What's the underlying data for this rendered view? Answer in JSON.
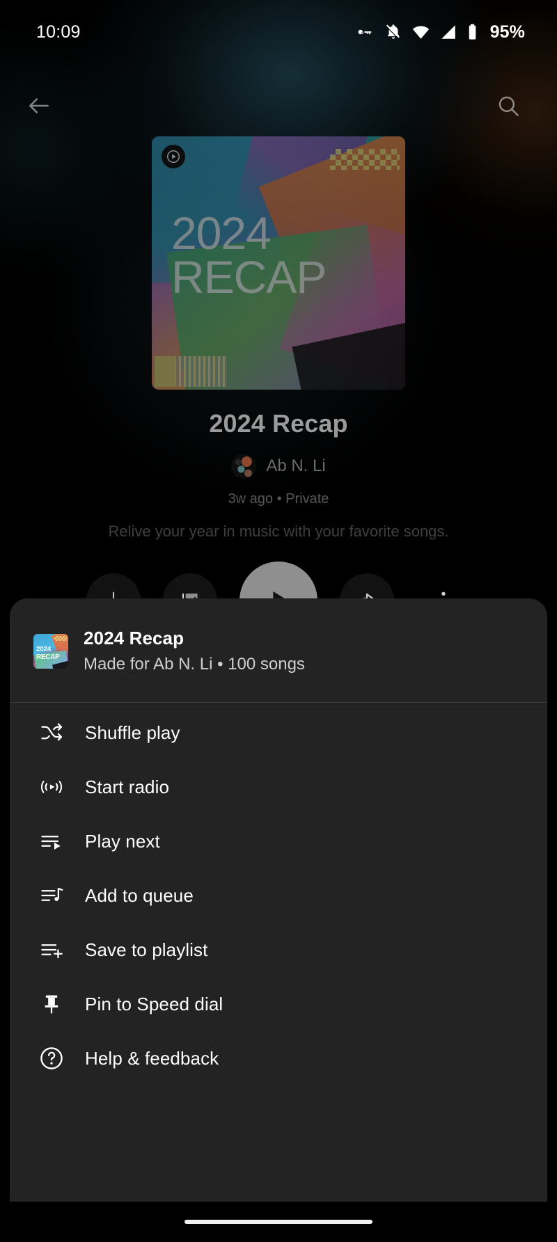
{
  "status_bar": {
    "time": "10:09",
    "battery_percent": "95%",
    "icons": [
      "key-icon",
      "notifications-muted-icon",
      "wifi-icon",
      "cellular-signal-icon",
      "battery-icon"
    ]
  },
  "app_bar": {
    "back_label": "back-arrow-icon",
    "search_label": "search-icon"
  },
  "hero": {
    "artwork": {
      "line1": "2024",
      "line2": "RECAP",
      "badge": "play-badge-icon"
    },
    "title": "2024 Recap",
    "owner": "Ab N. Li",
    "meta": "3w ago • Private",
    "description": "Relive your year in music with your favorite songs."
  },
  "actions": [
    {
      "name": "download-button",
      "icon": "download-arrow-icon"
    },
    {
      "name": "saved-button",
      "icon": "library-saved-check-icon"
    },
    {
      "name": "play-button",
      "icon": "play-icon"
    },
    {
      "name": "share-button",
      "icon": "share-arrow-icon"
    },
    {
      "name": "more-button",
      "icon": "overflow-menu-icon"
    }
  ],
  "sheet": {
    "header": {
      "thumbnail_line1": "2024",
      "thumbnail_line2": "RECAP",
      "title": "2024 Recap",
      "subtitle": "Made for Ab N. Li • 100 songs"
    },
    "menu_items": [
      {
        "label": "Shuffle play",
        "icon": "shuffle-icon",
        "name": "menu-item-shuffle-play"
      },
      {
        "label": "Start radio",
        "icon": "radio-icon",
        "name": "menu-item-start-radio"
      },
      {
        "label": "Play next",
        "icon": "play-next-icon",
        "name": "menu-item-play-next"
      },
      {
        "label": "Add to queue",
        "icon": "add-to-queue-icon",
        "name": "menu-item-add-to-queue"
      },
      {
        "label": "Save to playlist",
        "icon": "save-to-playlist-icon",
        "name": "menu-item-save-to-playlist"
      },
      {
        "label": "Pin to Speed dial",
        "icon": "pin-icon",
        "name": "menu-item-pin-to-speed-dial"
      },
      {
        "label": "Help & feedback",
        "icon": "help-circle-icon",
        "name": "menu-item-help-and-feedback"
      }
    ]
  },
  "navigation_bar": {
    "pill": "home-gesture-pill"
  },
  "colors": {
    "sheet_background": "#232323",
    "page_background": "#000000",
    "primary_text": "#ffffff",
    "secondary_text": "#cfcfcf",
    "play_button": "#8f8f8f"
  }
}
